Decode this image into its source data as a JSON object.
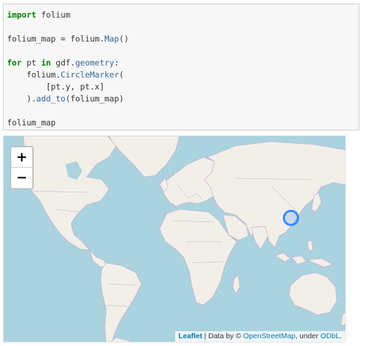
{
  "code": {
    "line1": {
      "kw": "import",
      "rest": " folium"
    },
    "line3": {
      "a": "folium_map = folium.",
      "fn": "Map",
      "b": "()"
    },
    "line5": {
      "kw": "for",
      "a": " pt ",
      "kw2": "in",
      "b": " gdf.",
      "fn": "geometry",
      "c": ":"
    },
    "line6": {
      "a": "    folium.",
      "fn": "CircleMarker",
      "b": "("
    },
    "line7": {
      "a": "        [pt.y, pt.x]"
    },
    "line8": {
      "a": "    ).",
      "fn": "add_to",
      "b": "(folium_map)"
    },
    "line10": {
      "a": "folium_map"
    }
  },
  "map": {
    "zoom_in": "+",
    "zoom_out": "−",
    "marker": {
      "lat": 31,
      "lon": 121,
      "color": "#3388ff"
    },
    "colors": {
      "water": "#aad3df",
      "land": "#f2efe9",
      "border": "#c8a3c6"
    },
    "attribution": {
      "leaflet": "Leaflet",
      "sep1": " | Data by © ",
      "osm": "OpenStreetMap",
      "sep2": ", under ",
      "odbl": "ODbL",
      "end": "."
    }
  }
}
